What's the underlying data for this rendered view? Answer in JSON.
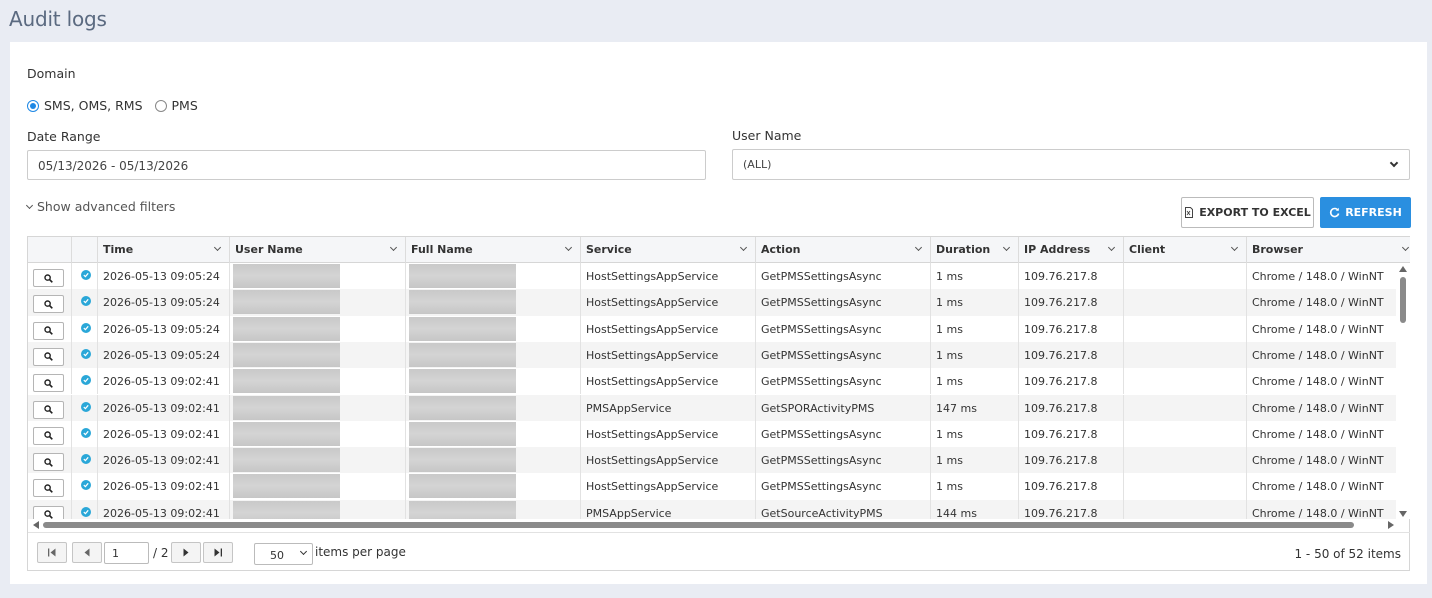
{
  "page": {
    "title": "Audit logs"
  },
  "filters": {
    "domain_label": "Domain",
    "domain_options": [
      {
        "label": "SMS, OMS, RMS",
        "selected": true
      },
      {
        "label": "PMS",
        "selected": false
      }
    ],
    "date_range_label": "Date Range",
    "date_range_value": "05/13/2026 - 05/13/2026",
    "user_name_label": "User Name",
    "user_name_value": "(ALL)",
    "advanced_label": "Show advanced filters"
  },
  "toolbar": {
    "export_label": "EXPORT TO EXCEL",
    "refresh_label": "REFRESH"
  },
  "colors": {
    "accent": "#2a8fe0",
    "status_ok": "#2aa7d8"
  },
  "grid": {
    "columns": [
      "Time",
      "User Name",
      "Full Name",
      "Service",
      "Action",
      "Duration",
      "IP Address",
      "Client",
      "Browser"
    ],
    "rows": [
      {
        "time": "2026-05-13 09:05:24",
        "service": "HostSettingsAppService",
        "action": "GetPMSSettingsAsync",
        "duration": "1 ms",
        "ip": "109.76.217.8",
        "client": "",
        "browser": "Chrome / 148.0 / WinNT"
      },
      {
        "time": "2026-05-13 09:05:24",
        "service": "HostSettingsAppService",
        "action": "GetPMSSettingsAsync",
        "duration": "1 ms",
        "ip": "109.76.217.8",
        "client": "",
        "browser": "Chrome / 148.0 / WinNT"
      },
      {
        "time": "2026-05-13 09:05:24",
        "service": "HostSettingsAppService",
        "action": "GetPMSSettingsAsync",
        "duration": "1 ms",
        "ip": "109.76.217.8",
        "client": "",
        "browser": "Chrome / 148.0 / WinNT"
      },
      {
        "time": "2026-05-13 09:05:24",
        "service": "HostSettingsAppService",
        "action": "GetPMSSettingsAsync",
        "duration": "1 ms",
        "ip": "109.76.217.8",
        "client": "",
        "browser": "Chrome / 148.0 / WinNT"
      },
      {
        "time": "2026-05-13 09:02:41",
        "service": "HostSettingsAppService",
        "action": "GetPMSSettingsAsync",
        "duration": "1 ms",
        "ip": "109.76.217.8",
        "client": "",
        "browser": "Chrome / 148.0 / WinNT"
      },
      {
        "time": "2026-05-13 09:02:41",
        "service": "PMSAppService",
        "action": "GetSPORActivityPMS",
        "duration": "147 ms",
        "ip": "109.76.217.8",
        "client": "",
        "browser": "Chrome / 148.0 / WinNT"
      },
      {
        "time": "2026-05-13 09:02:41",
        "service": "HostSettingsAppService",
        "action": "GetPMSSettingsAsync",
        "duration": "1 ms",
        "ip": "109.76.217.8",
        "client": "",
        "browser": "Chrome / 148.0 / WinNT"
      },
      {
        "time": "2026-05-13 09:02:41",
        "service": "HostSettingsAppService",
        "action": "GetPMSSettingsAsync",
        "duration": "1 ms",
        "ip": "109.76.217.8",
        "client": "",
        "browser": "Chrome / 148.0 / WinNT"
      },
      {
        "time": "2026-05-13 09:02:41",
        "service": "HostSettingsAppService",
        "action": "GetPMSSettingsAsync",
        "duration": "1 ms",
        "ip": "109.76.217.8",
        "client": "",
        "browser": "Chrome / 148.0 / WinNT"
      },
      {
        "time": "2026-05-13 09:02:41",
        "service": "PMSAppService",
        "action": "GetSourceActivityPMS",
        "duration": "144 ms",
        "ip": "109.76.217.8",
        "client": "",
        "browser": "Chrome / 148.0 / WinNT"
      }
    ]
  },
  "pager": {
    "current_page": "1",
    "total_pages_text": "/ 2",
    "page_size": "50",
    "items_per_page_label": "items per page",
    "summary": "1 - 50 of 52 items"
  }
}
